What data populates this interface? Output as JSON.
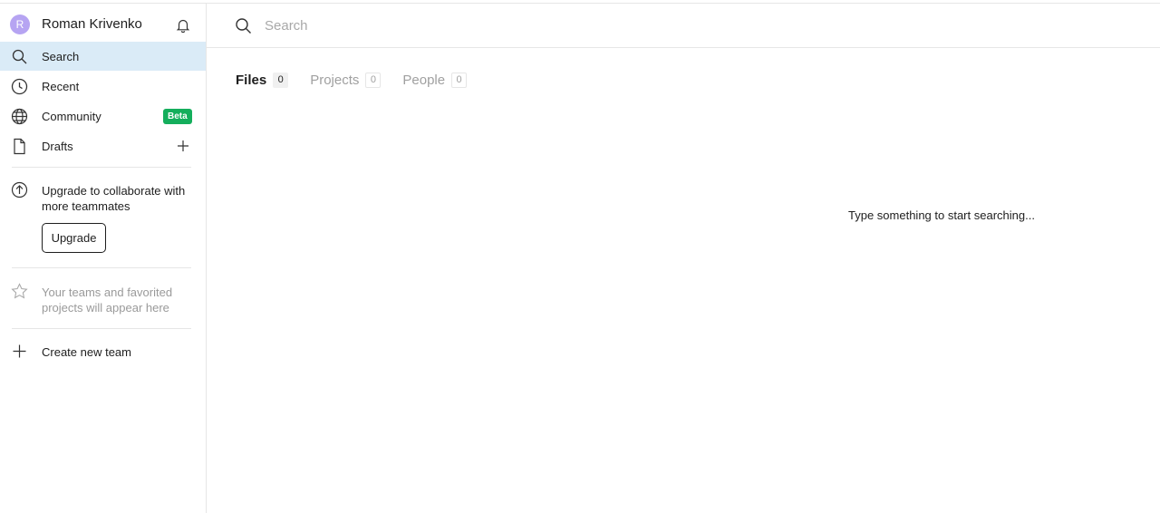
{
  "user": {
    "initial": "R",
    "name": "Roman Krivenko",
    "avatar_color": "#b6a4f2"
  },
  "nav": {
    "items": [
      {
        "label": "Search",
        "icon": "search-icon",
        "active": true
      },
      {
        "label": "Recent",
        "icon": "clock-icon"
      },
      {
        "label": "Community",
        "icon": "globe-icon",
        "badge": "Beta"
      },
      {
        "label": "Drafts",
        "icon": "file-icon"
      }
    ]
  },
  "upgrade": {
    "text": "Upgrade to collaborate with more teammates",
    "button_label": "Upgrade"
  },
  "teams": {
    "empty_text": "Your teams and favorited projects will appear here",
    "create_label": "Create new team"
  },
  "search": {
    "placeholder": "Search",
    "value": ""
  },
  "tabs": [
    {
      "label": "Files",
      "count": "0",
      "active": true
    },
    {
      "label": "Projects",
      "count": "0"
    },
    {
      "label": "People",
      "count": "0"
    }
  ],
  "empty_hint": "Type something to start searching...",
  "colors": {
    "active_nav": "#daebf7",
    "beta": "#14ae5c",
    "border": "#e6e6e6"
  }
}
